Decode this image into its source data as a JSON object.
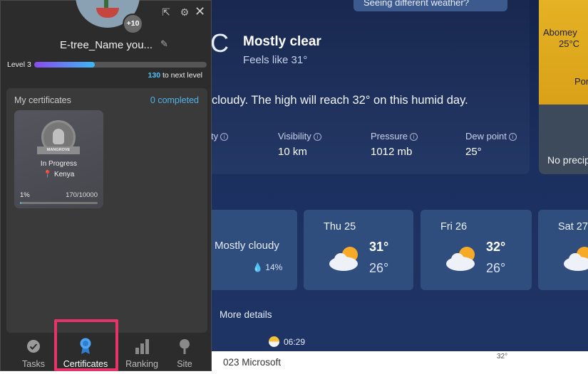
{
  "weather": {
    "seeing_button": "Seeing different weather?",
    "temp_unit_fragment": "C",
    "condition": "Mostly clear",
    "feels_like": "Feels like   31°",
    "summary": "cloudy. The high will reach 32° on this humid day.",
    "stats": [
      {
        "label": "ty",
        "value": ""
      },
      {
        "label": "Visibility",
        "value": "10 km"
      },
      {
        "label": "Pressure",
        "value": "1012 mb"
      },
      {
        "label": "Dew point",
        "value": "25°"
      }
    ],
    "map": {
      "city1": "Abomey",
      "city1_temp": "25°C",
      "city2": "Por",
      "no_precip": "No precip"
    },
    "forecast": [
      {
        "day": "",
        "condition": "Mostly cloudy",
        "precip": "14%"
      },
      {
        "day": "Thu 25",
        "high": "31°",
        "low": "26°"
      },
      {
        "day": "Fri 26",
        "high": "32°",
        "low": "26°"
      },
      {
        "day": "Sat 27",
        "high": "",
        "low": ""
      }
    ],
    "more_details": "More details",
    "sunrise": "06:29",
    "footer": "023 Microsoft",
    "footer_number": "32°"
  },
  "panel": {
    "plus_badge": "+10",
    "username": "E-tree_Name you...",
    "level": "Level 3",
    "level_progress": 0.35,
    "to_next_value": "130",
    "to_next_label": " to next level",
    "certificates_title": "My certificates",
    "completed": "0 completed",
    "cert": {
      "badge_text": "MANGROVE",
      "status": "In Progress",
      "location": "Kenya",
      "percent": "1%",
      "progress_text": "170/10000",
      "progress": 0.017
    },
    "nav": [
      {
        "label": "Tasks"
      },
      {
        "label": "Certificates"
      },
      {
        "label": "Ranking"
      },
      {
        "label": "Site"
      }
    ]
  },
  "colors": {
    "accent": "#4fb3e8",
    "highlight": "#e8336a",
    "level_bar_start": "#8a4af0",
    "level_bar_end": "#3bb8f5"
  }
}
